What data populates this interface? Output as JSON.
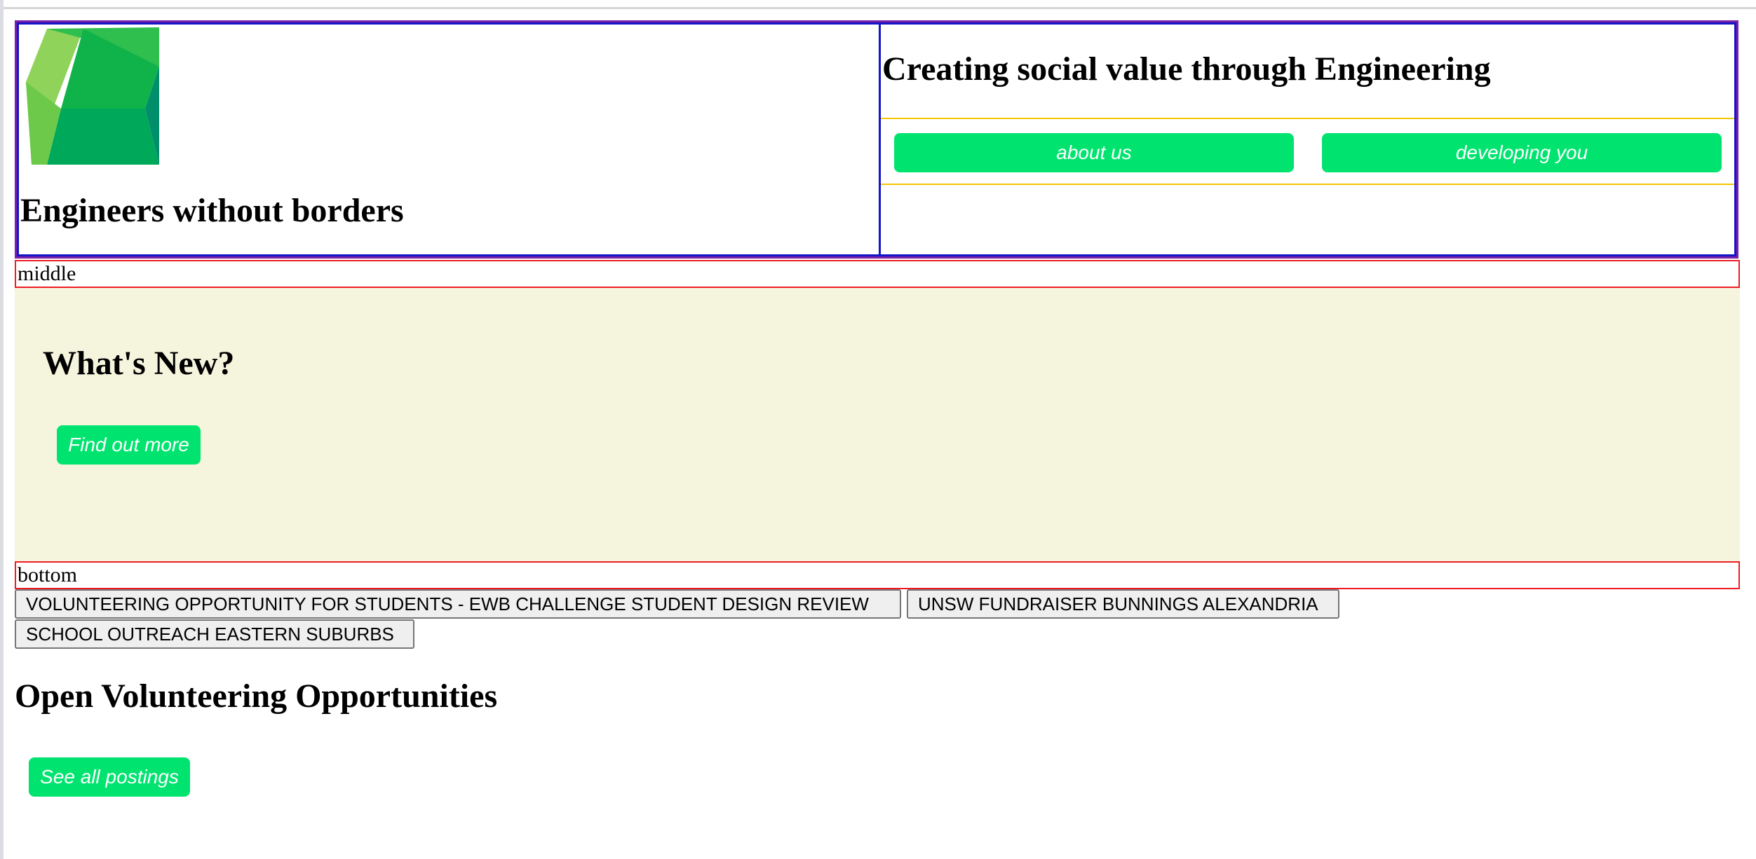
{
  "header": {
    "org_name": "Engineers without borders",
    "tagline": "Creating social value through Engineering",
    "nav": [
      {
        "label": "about us"
      },
      {
        "label": "developing you"
      }
    ]
  },
  "middle_label": "middle",
  "whats_new": {
    "title": "What's New?",
    "button_label": "Find out more"
  },
  "bottom_label": "bottom",
  "tags": [
    "VOLUNTEERING OPPORTUNITY FOR STUDENTS - EWB CHALLENGE STUDENT DESIGN REVIEW",
    "UNSW FUNDRAISER BUNNINGS ALEXANDRIA",
    "SCHOOL OUTREACH EASTERN SUBURBS"
  ],
  "open": {
    "title": "Open Volunteering Opportunities",
    "button_label": "See all postings"
  },
  "colors": {
    "accent_green": "#00e46f",
    "panel_beige": "#f5f5de",
    "debug_red": "#ee1b24",
    "debug_blue": "#1414c8",
    "debug_yellow": "#f5c400"
  },
  "icons": {
    "logo": "green-polyhedron-logo"
  }
}
